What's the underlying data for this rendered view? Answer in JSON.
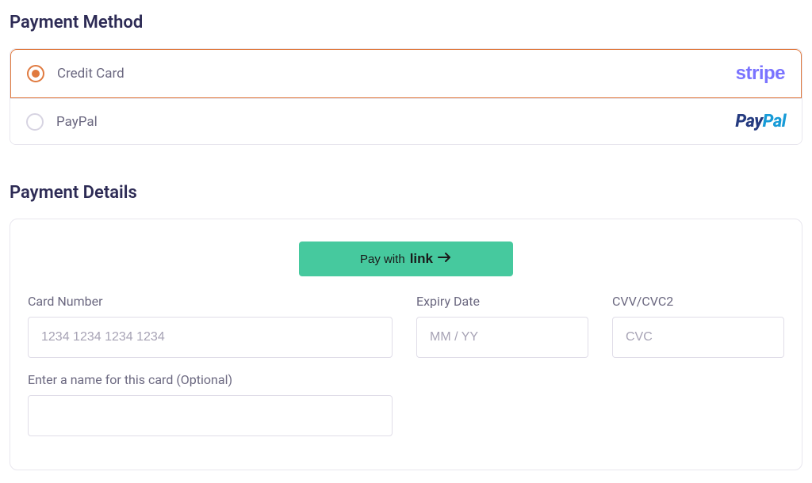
{
  "payment_method": {
    "title": "Payment Method",
    "options": [
      {
        "id": "credit-card",
        "label": "Credit Card",
        "brand": "stripe",
        "selected": true
      },
      {
        "id": "paypal",
        "label": "PayPal",
        "brand": "paypal",
        "selected": false
      }
    ],
    "brands": {
      "stripe_text": "stripe",
      "paypal_pay": "Pay",
      "paypal_pal": "Pal"
    }
  },
  "payment_details": {
    "title": "Payment Details",
    "pay_with_link_prefix": "Pay with",
    "pay_with_link_word": "link",
    "fields": {
      "card_number": {
        "label": "Card Number",
        "placeholder": "1234 1234 1234 1234",
        "value": ""
      },
      "expiry": {
        "label": "Expiry Date",
        "placeholder": "MM / YY",
        "value": ""
      },
      "cvv": {
        "label": "CVV/CVC2",
        "placeholder": "CVC",
        "value": ""
      },
      "card_name": {
        "label": "Enter a name for this card (Optional)",
        "placeholder": "",
        "value": ""
      }
    }
  },
  "colors": {
    "accent": "#e07a3f",
    "link_button": "#46c99e",
    "stripe": "#7a73ff"
  }
}
